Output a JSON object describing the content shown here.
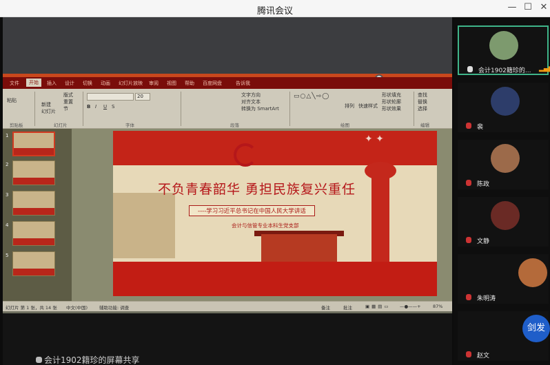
{
  "window": {
    "title": "腾讯会议",
    "minimize_icon": "minimize-icon",
    "maximize_icon": "maximize-icon",
    "close_icon": "close-icon"
  },
  "share": {
    "sharer_label": "会计1902籍珍的屏幕共享"
  },
  "ppt": {
    "tabs": [
      "文件",
      "开始",
      "插入",
      "设计",
      "切换",
      "动画",
      "幻灯片放映",
      "审阅",
      "视图",
      "帮助",
      "百度网盘",
      "告诉我"
    ],
    "active_tab": "开始",
    "groups": {
      "clipboard": "剪贴板",
      "clipboard_paste": "粘贴",
      "slides": "幻灯片",
      "new_slide": "新建\n幻灯片",
      "layout": "版式",
      "reset": "重置",
      "section": "节",
      "font": "字体",
      "font_size": "20",
      "paragraph": "段落",
      "text_direction": "文字方向",
      "align_text": "对齐文本",
      "smartart": "转换为 SmartArt",
      "drawing": "绘图",
      "arrange": "排列",
      "quick_styles": "快速样式",
      "shape_fill": "形状填充",
      "shape_outline": "形状轮廓",
      "shape_effects": "形状效果",
      "editing": "编辑",
      "find": "查找",
      "replace": "替换",
      "select": "选择"
    },
    "thumbnail_numbers": [
      "1",
      "2",
      "3",
      "4",
      "5"
    ],
    "slide": {
      "title": "不负青春韶华 勇担民族复兴重任",
      "subtitle": "----学习习近平总书记在中国人民大学讲话",
      "org": "会计与信管专业本科生党支部"
    },
    "status": {
      "slide_count": "幻灯片 第 1 张，共 14 张",
      "language": "中文(中国)",
      "accessibility": "辅助功能: 调查",
      "notes": "备注",
      "comments": "批注",
      "zoom": "87%"
    }
  },
  "participants": [
    {
      "name": "会计1902籍珍的...",
      "active": true,
      "avatar_color": "#7d9a6e"
    },
    {
      "name": "裴",
      "active": false,
      "avatar_color": "#2d3d6a"
    },
    {
      "name": "陈政",
      "active": false,
      "avatar_color": "#9c6a4a"
    },
    {
      "name": "文静",
      "active": false,
      "avatar_color": "#6a2a25"
    },
    {
      "name": "朱明涛",
      "active": false,
      "avatar_color": "#b46a3a"
    },
    {
      "name": "赵文",
      "active": false,
      "avatar_color": "#333333"
    }
  ],
  "floating_avatar": {
    "label": "剑发",
    "color": "#1f5ec9"
  },
  "colors": {
    "accent": "#3fb58a",
    "ribbon_red": "#7a0d0a",
    "slide_red": "#b5171a"
  }
}
